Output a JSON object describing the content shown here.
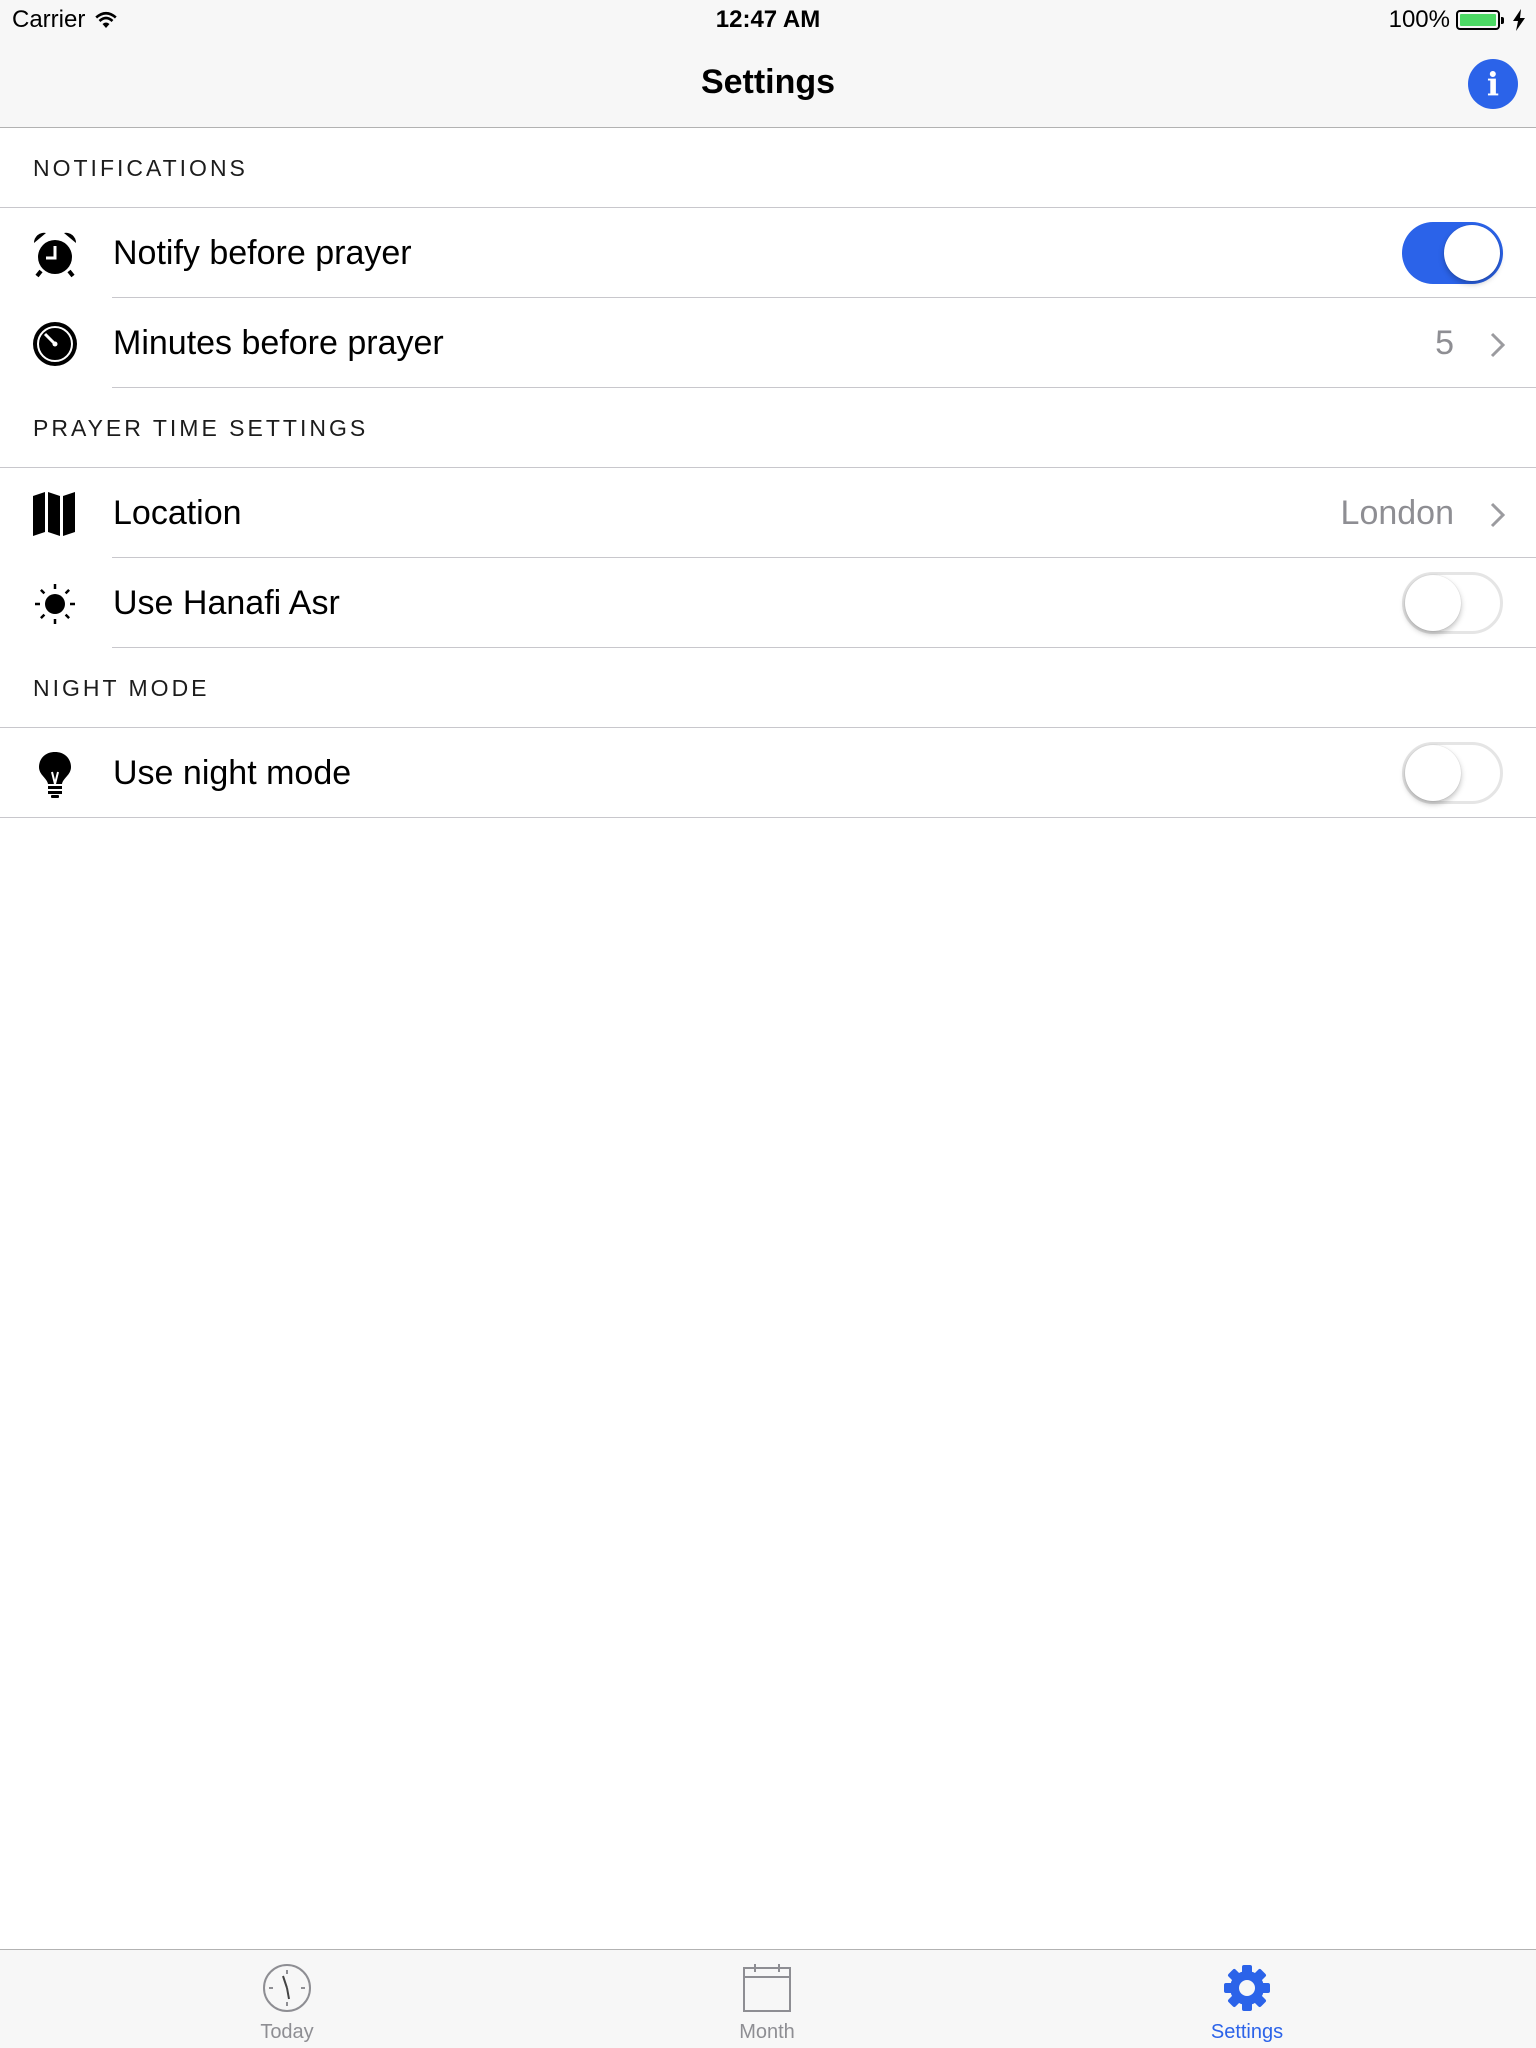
{
  "status_bar": {
    "carrier": "Carrier",
    "time": "12:47 AM",
    "battery": "100%"
  },
  "nav": {
    "title": "Settings",
    "info_icon": "info-icon",
    "info_glyph": "i"
  },
  "sections": [
    {
      "header": "NOTIFICATIONS",
      "rows": [
        {
          "icon": "alarm-clock-icon",
          "label": "Notify before prayer",
          "control": "toggle",
          "on": true
        },
        {
          "icon": "stopwatch-icon",
          "label": "Minutes before prayer",
          "control": "disclosure",
          "value": "5"
        }
      ]
    },
    {
      "header": "PRAYER TIME SETTINGS",
      "rows": [
        {
          "icon": "map-icon",
          "label": "Location",
          "control": "disclosure",
          "value": "London"
        },
        {
          "icon": "sun-icon",
          "label": "Use Hanafi Asr",
          "control": "toggle",
          "on": false
        }
      ]
    },
    {
      "header": "NIGHT MODE",
      "rows": [
        {
          "icon": "lightbulb-icon",
          "label": "Use night mode",
          "control": "toggle",
          "on": false
        }
      ]
    }
  ],
  "tab_bar": {
    "tabs": [
      {
        "label": "Today",
        "icon": "clock-icon",
        "active": false
      },
      {
        "label": "Month",
        "icon": "calendar-icon",
        "active": false
      },
      {
        "label": "Settings",
        "icon": "gear-icon",
        "active": true
      }
    ]
  },
  "colors": {
    "accent": "#2b63e9",
    "battery": "#4cd964",
    "secondary_text": "#8e8e93",
    "separator": "#c8c7cc",
    "bar_background": "#f7f7f7"
  }
}
